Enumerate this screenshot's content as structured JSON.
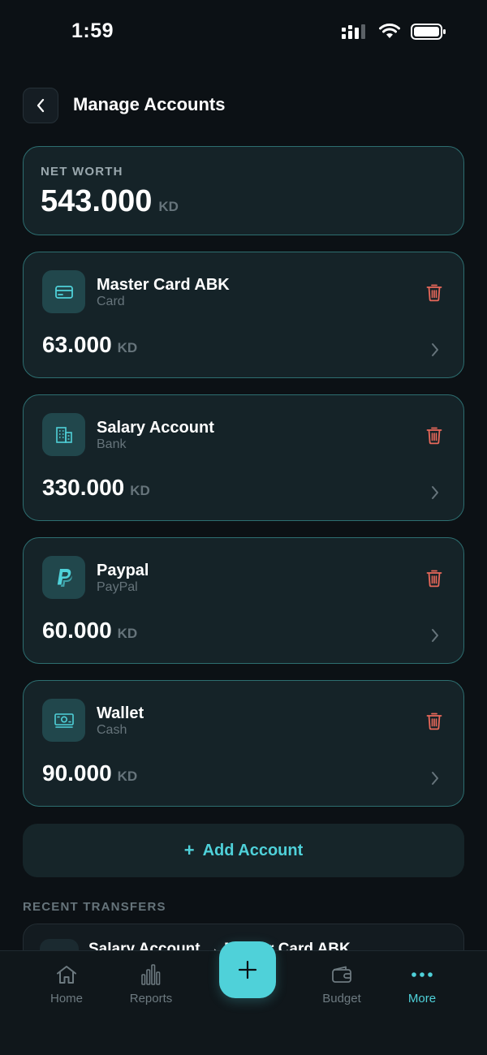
{
  "status_bar": {
    "time": "1:59"
  },
  "header": {
    "title": "Manage Accounts"
  },
  "net_worth": {
    "label": "NET WORTH",
    "amount": "543.000",
    "currency": "KD"
  },
  "accounts": [
    {
      "name": "Master Card ABK",
      "type": "Card",
      "balance": "63.000",
      "currency": "KD",
      "icon": "credit-card-icon"
    },
    {
      "name": "Salary Account",
      "type": "Bank",
      "balance": "330.000",
      "currency": "KD",
      "icon": "bank-building-icon"
    },
    {
      "name": "Paypal",
      "type": "PayPal",
      "balance": "60.000",
      "currency": "KD",
      "icon": "paypal-icon"
    },
    {
      "name": "Wallet",
      "type": "Cash",
      "balance": "90.000",
      "currency": "KD",
      "icon": "cash-icon"
    }
  ],
  "add_account": {
    "plus": "+",
    "label": "Add Account"
  },
  "recent_transfers": {
    "title": "RECENT TRANSFERS",
    "items": [
      {
        "title": "Salary Account → Master Card ABK"
      }
    ]
  },
  "bottom_nav": {
    "items": [
      {
        "label": "Home",
        "icon": "home-icon"
      },
      {
        "label": "Reports",
        "icon": "bar-chart-icon"
      },
      {
        "label": "Budget",
        "icon": "wallet-icon"
      },
      {
        "label": "More",
        "icon": "more-dots-icon",
        "active": true
      }
    ]
  },
  "colors": {
    "background": "#0c1115",
    "card": "#152328",
    "card_border": "#2d6e70",
    "accent": "#4fd1d9",
    "delete": "#e8685a",
    "muted": "#66747b"
  }
}
